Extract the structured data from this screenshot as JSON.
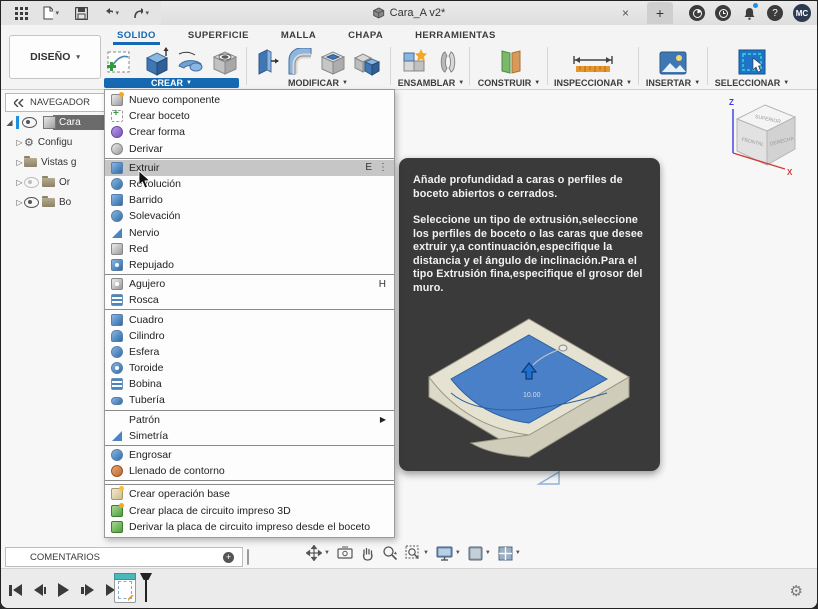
{
  "colors": {
    "accent": "#1569b3",
    "menu_highlight": "#c6c6c6",
    "tooltip_bg": "#3a3a3a",
    "tab_active": "#1568b4"
  },
  "titlebar": {
    "title": "Cara_A v2*",
    "avatar": "MC",
    "close": "×",
    "new_tab": "+",
    "help": "?"
  },
  "tabs": [
    {
      "label": "SOLIDO",
      "active": true
    },
    {
      "label": "SUPERFICIE",
      "active": false
    },
    {
      "label": "MALLA",
      "active": false
    },
    {
      "label": "CHAPA",
      "active": false
    },
    {
      "label": "HERRAMIENTAS",
      "active": false
    }
  ],
  "toolbar": {
    "design_label": "DISEÑO",
    "groups": [
      {
        "label": "CREAR",
        "open": true
      },
      {
        "label": "MODIFICAR"
      },
      {
        "label": "ENSAMBLAR"
      },
      {
        "label": "CONSTRUIR"
      },
      {
        "label": "INSPECCIONAR"
      },
      {
        "label": "INSERTAR"
      },
      {
        "label": "SELECCIONAR"
      }
    ]
  },
  "navigator": {
    "header": "NAVEGADOR",
    "collapse_icon": "chevrons-left",
    "items": [
      {
        "label": "Cara",
        "selected": true
      },
      {
        "label": "Configu"
      },
      {
        "label": "Vistas g"
      },
      {
        "label": "Or",
        "hidden_eye": true
      },
      {
        "label": "Bo"
      }
    ]
  },
  "menu": {
    "items": [
      {
        "label": "Nuevo componente",
        "icon": "new-component-icon"
      },
      {
        "label": "Crear boceto",
        "icon": "create-sketch-icon"
      },
      {
        "label": "Crear forma",
        "icon": "create-form-icon"
      },
      {
        "label": "Derivar",
        "icon": "derive-icon"
      },
      {
        "label": "Extruir",
        "shortcut": "E",
        "icon": "extrude-icon",
        "highlighted": true
      },
      {
        "label": "Revolución",
        "icon": "revolve-icon"
      },
      {
        "label": "Barrido",
        "icon": "sweep-icon"
      },
      {
        "label": "Solevación",
        "icon": "loft-icon"
      },
      {
        "label": "Nervio",
        "icon": "rib-icon"
      },
      {
        "label": "Red",
        "icon": "web-icon"
      },
      {
        "label": "Repujado",
        "icon": "emboss-icon"
      },
      {
        "label": "Agujero",
        "shortcut": "H",
        "icon": "hole-icon"
      },
      {
        "label": "Rosca",
        "icon": "thread-icon"
      },
      {
        "label": "Cuadro",
        "icon": "box-icon"
      },
      {
        "label": "Cilindro",
        "icon": "cylinder-icon"
      },
      {
        "label": "Esfera",
        "icon": "sphere-icon"
      },
      {
        "label": "Toroide",
        "icon": "torus-icon"
      },
      {
        "label": "Bobina",
        "icon": "coil-icon"
      },
      {
        "label": "Tubería",
        "icon": "pipe-icon"
      },
      {
        "label": "Patrón",
        "submenu": true
      },
      {
        "label": "Simetría",
        "icon": "mirror-icon"
      },
      {
        "label": "Engrosar",
        "icon": "thicken-icon"
      },
      {
        "label": "Llenado de contorno",
        "icon": "boundary-fill-icon"
      },
      {
        "label": "Crear operación base",
        "icon": "base-feature-icon"
      },
      {
        "label": "Crear placa de circuito impreso 3D",
        "icon": "pcb-3d-icon"
      },
      {
        "label": "Derivar la placa de circuito impreso desde el boceto",
        "icon": "derive-pcb-icon"
      }
    ]
  },
  "tooltip": {
    "p1": "Añade profundidad a caras o perfiles de boceto abiertos o cerrados.",
    "p2": "Seleccione un tipo de extrusión,seleccione los perfiles de boceto o las caras que desee extruir y,a continuación,especifique la distancia y el ángulo de inclinación.Para el tipo Extrusión fina,especifique el grosor del muro.",
    "dim_label": "10.00"
  },
  "viewcube": {
    "axis_x": "X",
    "axis_z": "Z",
    "face_top": "SUPERIOR",
    "face_left": "FRONTAL",
    "face_right": "DERECHA"
  },
  "bottom": {
    "comments_label": "COMENTARIOS"
  }
}
